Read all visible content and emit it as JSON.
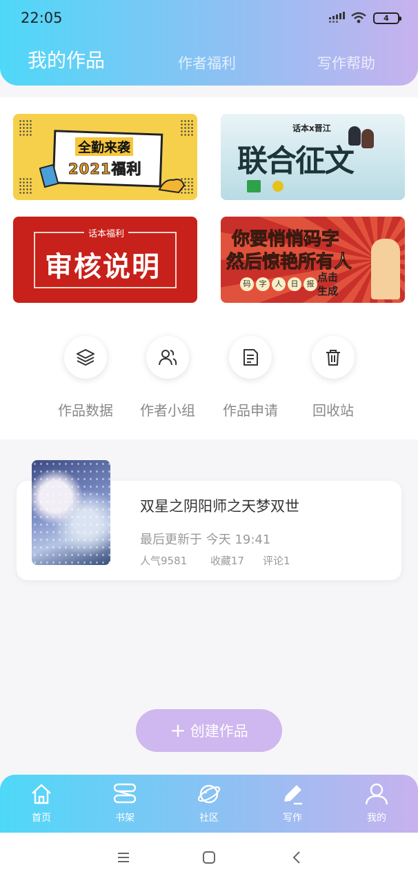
{
  "status_bar": {
    "time": "22:05",
    "battery": "4"
  },
  "header_tabs": [
    {
      "label": "我的作品",
      "active": true
    },
    {
      "label": "作者福利",
      "active": false
    },
    {
      "label": "写作帮助",
      "active": false
    }
  ],
  "banners": [
    {
      "line1": "全勤来袭",
      "line2": "2021福利"
    },
    {
      "small": "话本x晋江",
      "title": "联合征文"
    },
    {
      "caption": "话本福利",
      "title": "审核说明"
    },
    {
      "line1": "你要悄悄码字",
      "line2": "然后惊艳所有人",
      "chips": [
        "码",
        "字",
        "人",
        "日",
        "报"
      ],
      "cta1": "点击",
      "cta2": "生成"
    }
  ],
  "tools": [
    {
      "label": "作品数据",
      "icon": "layers-icon"
    },
    {
      "label": "作者小组",
      "icon": "users-icon"
    },
    {
      "label": "作品申请",
      "icon": "document-icon"
    },
    {
      "label": "回收站",
      "icon": "trash-icon"
    }
  ],
  "work": {
    "title": "双星之阴阳师之天梦双世",
    "updated": "最后更新于 今天 19:41",
    "popularity": "人气9581",
    "favorites": "收藏17",
    "comments": "评论1"
  },
  "create_button": {
    "label": "创建作品"
  },
  "bottom_nav": [
    {
      "label": "首页",
      "icon": "home-icon"
    },
    {
      "label": "书架",
      "icon": "bookshelf-icon"
    },
    {
      "label": "社区",
      "icon": "planet-icon"
    },
    {
      "label": "写作",
      "icon": "pen-icon",
      "active": true
    },
    {
      "label": "我的",
      "icon": "user-icon"
    }
  ],
  "colors": {
    "gradient_start": "#4ed8f8",
    "gradient_end": "#c7b2ee",
    "create_button": "#cfb7ef"
  }
}
